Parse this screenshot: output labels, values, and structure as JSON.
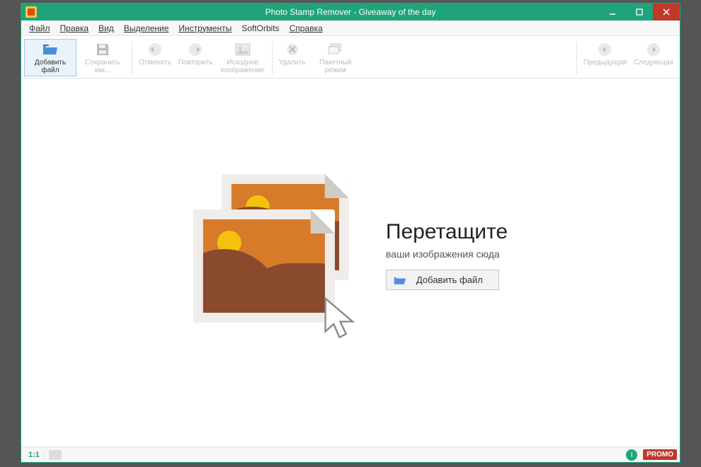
{
  "title": "Photo Stamp Remover - Giveaway of the day",
  "menu": {
    "file": "Файл",
    "edit": "Правка",
    "view": "Вид",
    "selection": "Выделение",
    "tools": "Инструменты",
    "softorbits": "SoftOrbits",
    "help": "Справка"
  },
  "toolbar": {
    "add_file": "Добавить файл",
    "save_as": "Сохранить как...",
    "undo": "Отменить",
    "redo": "Повторить",
    "original": "Исходное изображение",
    "delete": "Удалить",
    "batch": "Пакетный режим",
    "prev": "Предыдущая",
    "next": "Следующая"
  },
  "drop": {
    "heading": "Перетащите",
    "sub": "ваши изображения сюда",
    "button": "Добавить файл"
  },
  "status": {
    "zoom": "1:1",
    "promo": "PROMO",
    "info": "i"
  }
}
